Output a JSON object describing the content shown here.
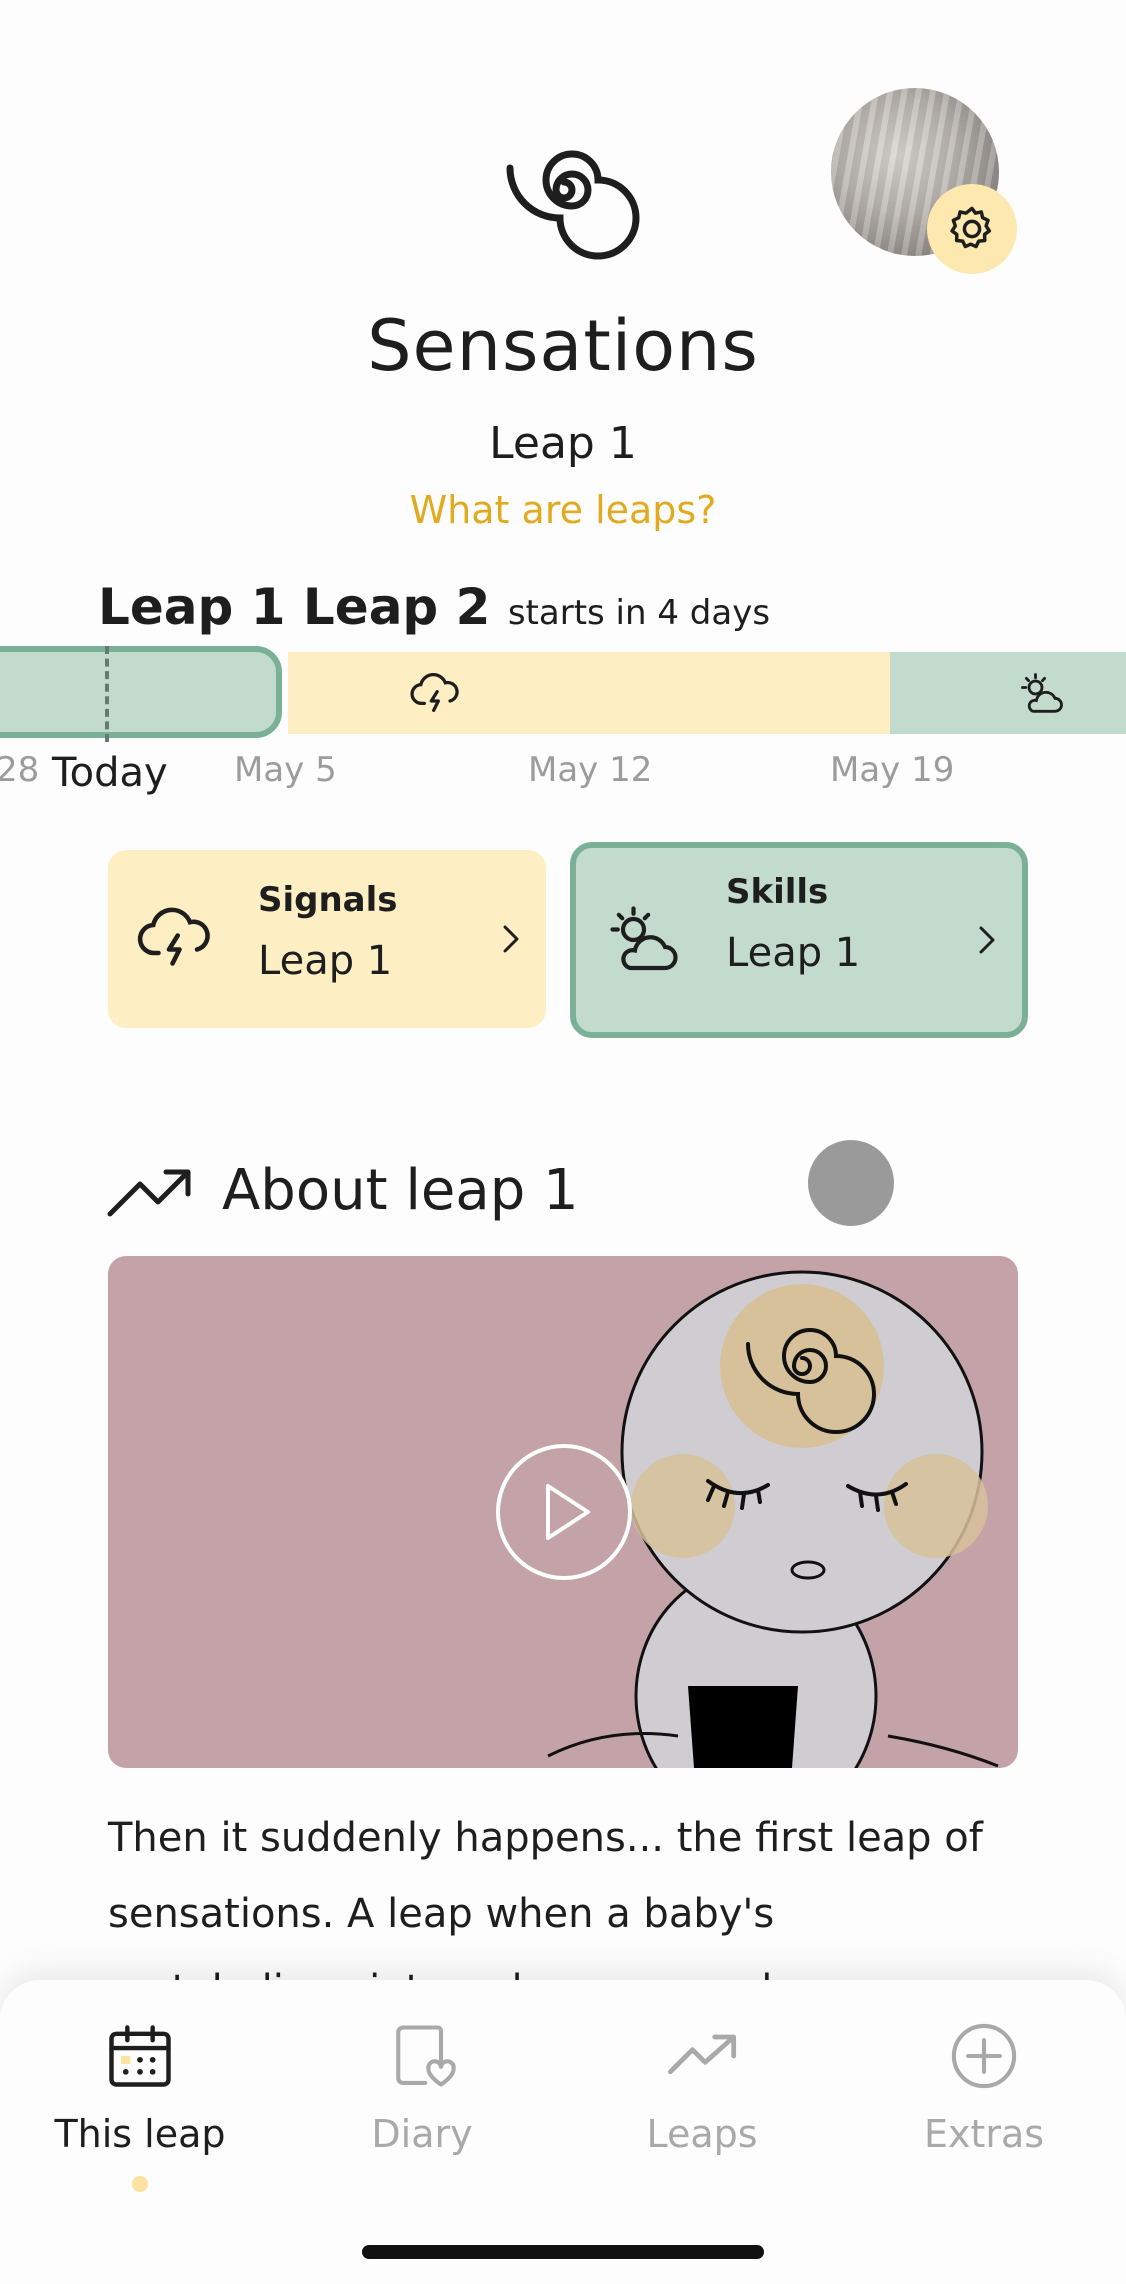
{
  "header": {
    "title": "Sensations",
    "subtitle": "Leap 1",
    "link": "What are leaps?"
  },
  "timeline": {
    "current_leap": "Leap 1",
    "next_leap": "Leap 2",
    "next_leap_note": "starts in 4 days",
    "dates": [
      "28",
      "May 5",
      "May 12",
      "May 19"
    ],
    "today_label": "Today"
  },
  "cards": [
    {
      "label": "Signals",
      "value": "Leap 1"
    },
    {
      "label": "Skills",
      "value": "Leap 1"
    }
  ],
  "about": {
    "title": "About leap 1",
    "description": "Then it suddenly happens... the first leap of sensations. A leap when a baby's metabolism, internal organs, and senses"
  },
  "tabs": [
    {
      "label": "This leap",
      "icon": "calendar-icon"
    },
    {
      "label": "Diary",
      "icon": "diary-heart-icon"
    },
    {
      "label": "Leaps",
      "icon": "trend-icon"
    },
    {
      "label": "Extras",
      "icon": "plus-circle-icon"
    }
  ],
  "colors": {
    "accent": "#e2aa1e",
    "signals_bg": "#fdeec3",
    "skills_bg": "#c3dbcc",
    "skills_border": "#7ab196",
    "video_bg": "#c4a3a8"
  }
}
